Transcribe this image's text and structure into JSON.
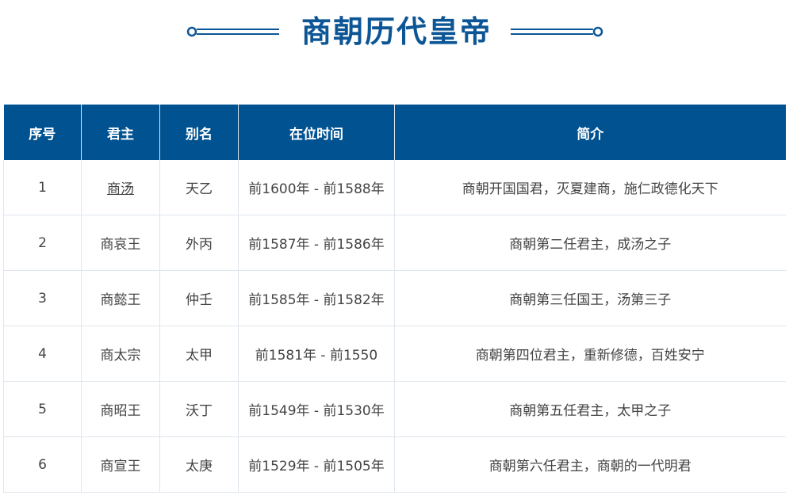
{
  "title": "商朝历代皇帝",
  "colors": {
    "accent": "#0d5696",
    "header_bg": "#005290",
    "border": "#dfe6ee",
    "text": "#444444"
  },
  "table": {
    "headers": [
      "序号",
      "君主",
      "别名",
      "在位时间",
      "简介"
    ],
    "rows": [
      [
        "1",
        "商汤",
        "天乙",
        "前1600年 - 前1588年",
        "商朝开国国君，灭夏建商，施仁政德化天下"
      ],
      [
        "2",
        "商哀王",
        "外丙",
        "前1587年 - 前1586年",
        "商朝第二任君主，成汤之子"
      ],
      [
        "3",
        "商懿王",
        "仲壬",
        "前1585年 - 前1582年",
        "商朝第三任国王，汤第三子"
      ],
      [
        "4",
        "商太宗",
        "太甲",
        "前1581年 - 前1550",
        "商朝第四位君主，重新修德，百姓安宁"
      ],
      [
        "5",
        "商昭王",
        "沃丁",
        "前1549年 - 前1530年",
        "商朝第五任君主，太甲之子"
      ],
      [
        "6",
        "商宣王",
        "太庚",
        "前1529年 - 前1505年",
        "商朝第六任君主，商朝的一代明君"
      ]
    ]
  }
}
